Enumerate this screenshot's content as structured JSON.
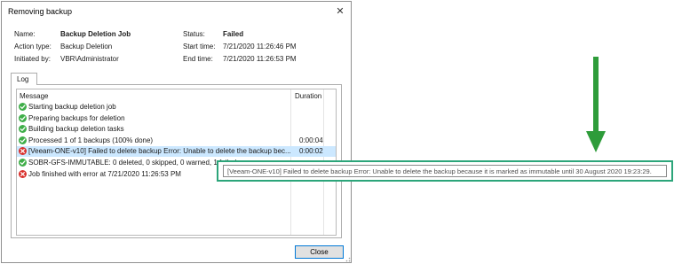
{
  "window": {
    "title": "Removing backup",
    "close_glyph": "✕"
  },
  "info": {
    "name_label": "Name:",
    "name_value": "Backup Deletion Job",
    "action_label": "Action type:",
    "action_value": "Backup Deletion",
    "initiated_label": "Initiated by:",
    "initiated_value": "VBR\\Administrator",
    "status_label": "Status:",
    "status_value": "Failed",
    "start_label": "Start time:",
    "start_value": "7/21/2020 11:26:46 PM",
    "end_label": "End time:",
    "end_value": "7/21/2020 11:26:53 PM"
  },
  "tabs": [
    {
      "label": "Log"
    }
  ],
  "log": {
    "columns": [
      "Message",
      "Duration"
    ],
    "rows": [
      {
        "status": "success",
        "icon": "success-check-icon",
        "message": "Starting backup deletion job",
        "duration": ""
      },
      {
        "status": "success",
        "icon": "success-check-icon",
        "message": "Preparing backups for deletion",
        "duration": ""
      },
      {
        "status": "success",
        "icon": "success-check-icon",
        "message": "Building backup deletion tasks",
        "duration": ""
      },
      {
        "status": "success",
        "icon": "success-check-icon",
        "message": "Processed 1 of 1 backups (100% done)",
        "duration": "0:00:04"
      },
      {
        "status": "error",
        "icon": "error-x-icon",
        "message": "[Veeam-ONE-v10] Failed to delete backup Error: Unable to delete the backup bec...",
        "duration": "0:00:02",
        "selected": true
      },
      {
        "status": "success",
        "icon": "success-check-icon",
        "message": "SOBR-GFS-IMMUTABLE: 0 deleted, 0 skipped, 0 warned, 1 failed",
        "duration": ""
      },
      {
        "status": "error",
        "icon": "error-x-icon",
        "message": "Job finished with error at 7/21/2020 11:26:53 PM",
        "duration": ""
      }
    ]
  },
  "tooltip": {
    "text": "[Veeam-ONE-v10] Failed to delete backup Error: Unable to delete the backup because it is marked as immutable until 30 August 2020 19:23:29."
  },
  "buttons": {
    "close_label": "Close"
  },
  "colors": {
    "success": "#3fae49",
    "error": "#d9302c",
    "selection": "#cce8ff",
    "annotation_arrow": "#2e9c3a",
    "tooltip_highlight": "#2ca57a"
  }
}
